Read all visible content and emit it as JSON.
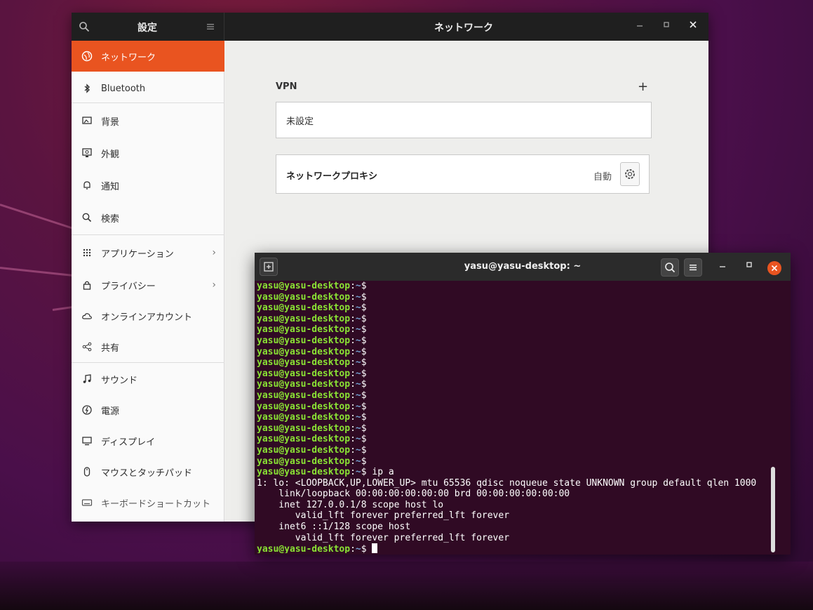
{
  "settings": {
    "sidebar_title": "設定",
    "page_title": "ネットワーク",
    "sidebar": [
      {
        "label": "ネットワーク",
        "icon": "globe-icon",
        "active": true
      },
      {
        "label": "Bluetooth",
        "icon": "bluetooth-icon"
      },
      {
        "label": "背景",
        "icon": "background-icon"
      },
      {
        "label": "外観",
        "icon": "appearance-icon"
      },
      {
        "label": "通知",
        "icon": "bell-icon"
      },
      {
        "label": "検索",
        "icon": "search-icon"
      },
      {
        "label": "アプリケーション",
        "icon": "apps-grid-icon",
        "chevron": "›"
      },
      {
        "label": "プライバシー",
        "icon": "lock-icon",
        "chevron": "›"
      },
      {
        "label": "オンラインアカウント",
        "icon": "cloud-icon"
      },
      {
        "label": "共有",
        "icon": "share-icon"
      },
      {
        "label": "サウンド",
        "icon": "music-note-icon"
      },
      {
        "label": "電源",
        "icon": "power-icon"
      },
      {
        "label": "ディスプレイ",
        "icon": "display-icon"
      },
      {
        "label": "マウスとタッチパッド",
        "icon": "mouse-icon"
      },
      {
        "label": "キーボードショートカット",
        "icon": "keyboard-icon"
      }
    ],
    "vpn": {
      "section_label": "VPN",
      "add_label": "+",
      "empty_label": "未設定"
    },
    "proxy": {
      "label": "ネットワークプロキシ",
      "status": "自動"
    }
  },
  "terminal": {
    "title": "yasu@yasu-desktop: ~",
    "prompt_user": "yasu@yasu-desktop",
    "prompt_sep": ":",
    "prompt_path": "~",
    "prompt_symbol": "$",
    "empty_prompt_count": 17,
    "command": " ip a",
    "output": [
      "1: lo: <LOOPBACK,UP,LOWER_UP> mtu 65536 qdisc noqueue state UNKNOWN group default qlen 1000",
      "    link/loopback 00:00:00:00:00:00 brd 00:00:00:00:00:00",
      "    inet 127.0.0.1/8 scope host lo",
      "       valid_lft forever preferred_lft forever",
      "    inet6 ::1/128 scope host",
      "       valid_lft forever preferred_lft forever"
    ]
  },
  "colors": {
    "accent": "#e95420",
    "terminal_bg": "#300a24",
    "prompt_user": "#8ae234",
    "prompt_path": "#729fcf"
  }
}
